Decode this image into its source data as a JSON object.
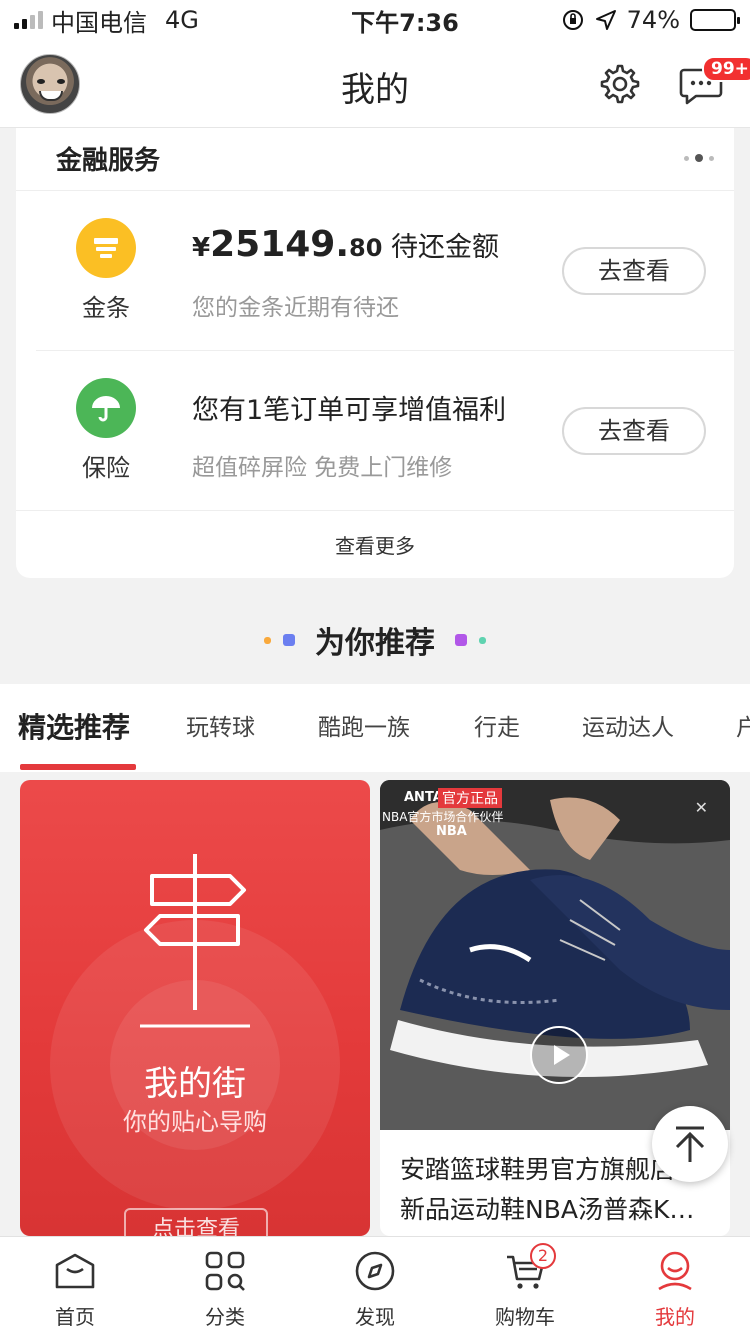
{
  "status_bar": {
    "carrier": "中国电信",
    "network": "4G",
    "time": "下午7:36",
    "battery": "74%",
    "battery_level": 0.74
  },
  "header": {
    "title": "我的",
    "message_badge": "99+"
  },
  "finance": {
    "title": "金融服务",
    "rows": [
      {
        "label": "金条",
        "currency": "¥",
        "amount_int": "25149.",
        "amount_dec": "80",
        "main_suffix": " 待还金额",
        "sub": "您的金条近期有待还",
        "button": "去查看",
        "icon_color": "#fbbf24"
      },
      {
        "label": "保险",
        "main": "您有1笔订单可享增值福利",
        "sub": "超值碎屏险 免费上门维修",
        "button": "去查看",
        "icon_color": "#4cb657"
      }
    ],
    "more": "查看更多"
  },
  "recommend": {
    "title": "为你推荐"
  },
  "tabs": [
    {
      "label": "精选推荐",
      "active": true
    },
    {
      "label": "玩转球",
      "active": false
    },
    {
      "label": "酷跑一族",
      "active": false
    },
    {
      "label": "行走",
      "active": false
    },
    {
      "label": "运动达人",
      "active": false
    },
    {
      "label": "户",
      "active": false
    }
  ],
  "cards": {
    "street": {
      "title": "我的街",
      "subtitle": "你的贴心导购",
      "button": "点击查看"
    },
    "product": {
      "brand": "ANTA",
      "brand_tag": "官方正品",
      "partner_line": "NBA官方市场合作伙伴",
      "league": "NBA",
      "title_line1": "安踏篮球鞋男官方旗舰店",
      "title_line2": "新品运动鞋NBA汤普森K…"
    }
  },
  "nav": {
    "items": [
      {
        "label": "首页",
        "active": false
      },
      {
        "label": "分类",
        "active": false
      },
      {
        "label": "发现",
        "active": false
      },
      {
        "label": "购物车",
        "active": false,
        "badge": "2"
      },
      {
        "label": "我的",
        "active": true
      }
    ]
  },
  "colors": {
    "accent": "#e4393c",
    "badge": "#f23030"
  }
}
